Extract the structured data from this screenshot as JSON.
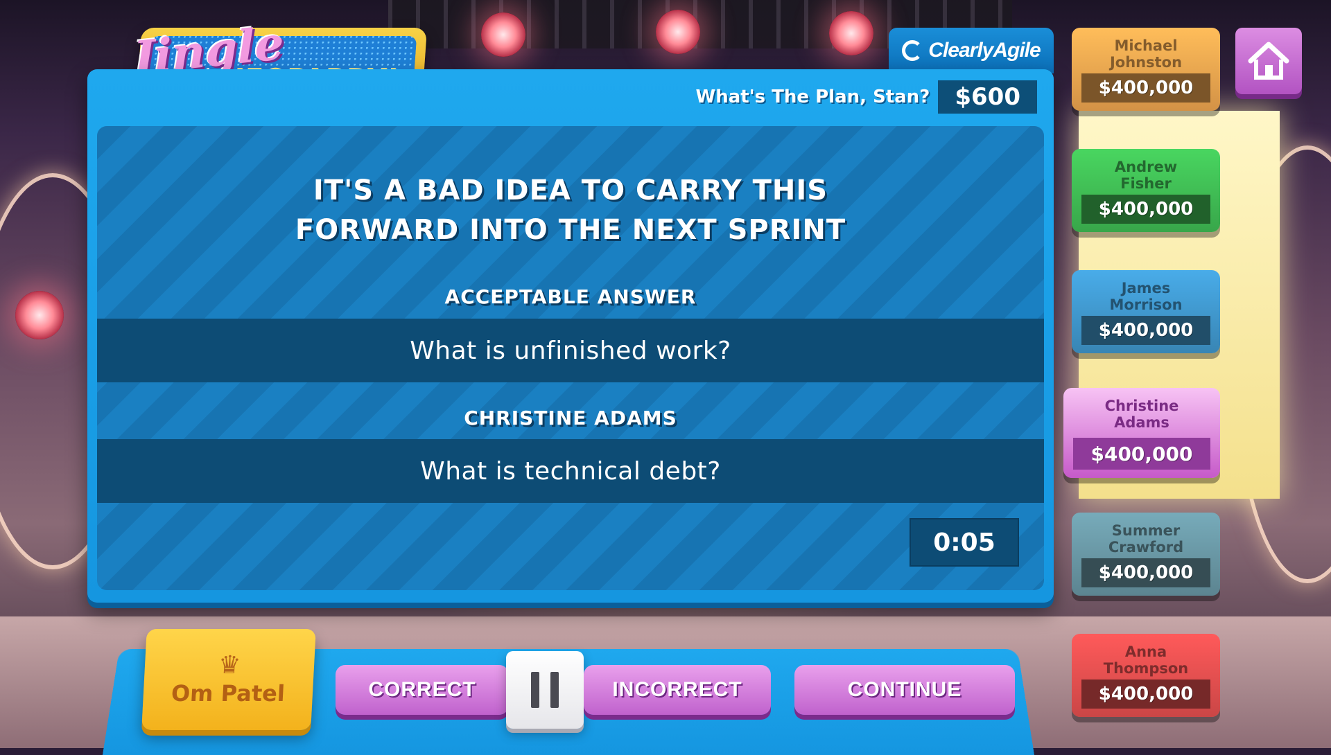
{
  "logo": {
    "script": "Jingle",
    "block": "JEOPARDY!"
  },
  "sponsor": {
    "name": "ClearlyAgile",
    "icon": "sponsor-swirl-icon"
  },
  "category": {
    "title": "What's The Plan, Stan?",
    "value": "$600"
  },
  "clue": {
    "text": "IT'S A BAD IDEA TO CARRY THIS FORWARD INTO THE NEXT SPRINT"
  },
  "acceptable": {
    "label": "ACCEPTABLE ANSWER",
    "answer": "What is unfinished work?"
  },
  "response": {
    "player": "CHRISTINE ADAMS",
    "answer": "What is technical debt?"
  },
  "timer": "0:05",
  "current_player": {
    "name": "Om Patel",
    "icon": "crown-icon"
  },
  "controls": {
    "correct": "CORRECT",
    "incorrect": "INCORRECT",
    "continue": "CONTINUE",
    "pause_icon": "pause-icon"
  },
  "home_icon": "home-icon",
  "players": [
    {
      "name": "Michael Johnston",
      "score": "$400,000",
      "color": "#b07a3a"
    },
    {
      "name": "Andrew Fisher",
      "score": "$400,000",
      "color": "#2f8a3e"
    },
    {
      "name": "James Morrison",
      "score": "$400,000",
      "color": "#2f6f96"
    },
    {
      "name": "Christine Adams",
      "score": "$400,000",
      "color": "#c65ac9",
      "active": true
    },
    {
      "name": "Summer Crawford",
      "score": "$400,000",
      "color": "#4d6e78"
    },
    {
      "name": "Anna Thompson",
      "score": "$400,000",
      "color": "#a83a3a"
    }
  ]
}
